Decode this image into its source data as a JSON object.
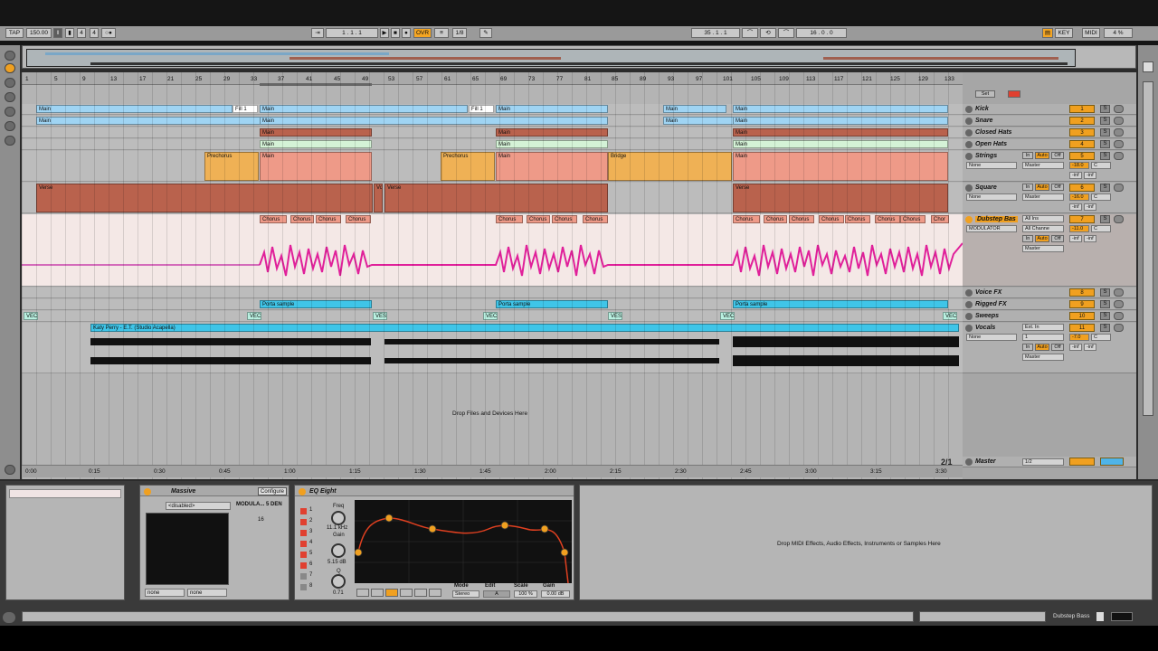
{
  "transport": {
    "tap": "TAP",
    "tempo": "150.00",
    "signature_num": "4",
    "signature_den": "4",
    "position": "1 . 1 . 1",
    "ovr": "OVR",
    "quant": "1/8",
    "loop_start": "35 . 1 . 1",
    "loop_length": "16 . 0 . 0",
    "key": "KEY",
    "midi": "MIDI",
    "cpu": "4 %"
  },
  "ruler_bars": [
    "1",
    "5",
    "9",
    "13",
    "17",
    "21",
    "25",
    "29",
    "33",
    "37",
    "41",
    "45",
    "49",
    "53",
    "57",
    "61",
    "65",
    "69",
    "73",
    "77",
    "81",
    "85",
    "89",
    "93",
    "97",
    "101",
    "105",
    "109",
    "113",
    "117",
    "121",
    "125",
    "129",
    "133"
  ],
  "timeline": [
    "0:00",
    "0:15",
    "0:30",
    "0:45",
    "1:00",
    "1:15",
    "1:30",
    "1:45",
    "2:00",
    "2:15",
    "2:30",
    "2:45",
    "3:00",
    "3:15",
    "3:30"
  ],
  "clips": {
    "main": "Main",
    "fill": "Fill 1",
    "prechorus": "Prechorus",
    "bridge": "Bridge",
    "verse": "Verse",
    "chorus": "Chorus",
    "porta": "Porta sample",
    "vec": "VEC",
    "ves": "VES",
    "vo": "Vo",
    "chor": "Chor",
    "acapella": "Katy Perry - E.T. (Studio Acapella)"
  },
  "drop_files": "Drop Files and Devices Here",
  "tracks": [
    {
      "name": "Kick",
      "num": "1"
    },
    {
      "name": "Snare",
      "num": "2"
    },
    {
      "name": "Closed Hats",
      "num": "3"
    },
    {
      "name": "Open Hats",
      "num": "4"
    },
    {
      "name": "Strings",
      "num": "5"
    },
    {
      "name": "Square",
      "num": "6"
    },
    {
      "name": "Dubstep Bas",
      "num": "7"
    },
    {
      "name": "Voice FX",
      "num": "8"
    },
    {
      "name": "Rigged FX",
      "num": "9"
    },
    {
      "name": "Sweeps",
      "num": "10"
    },
    {
      "name": "Vocals",
      "num": "11"
    }
  ],
  "master": {
    "name": "Master",
    "route": "1/2",
    "zoom": "2/1"
  },
  "track_fields": {
    "none": "None",
    "master": "Master",
    "in": "In",
    "auto": "Auto",
    "off": "Off",
    "all_ins": "All Ins",
    "all_channels": "All Channe",
    "modulator": "MODULATOR",
    "ext_in": "Ext. In",
    "one": "1",
    "s": "S",
    "set": "Set",
    "c": "C",
    "inf": "-inf",
    "strings_vol": "-18.0",
    "square_vol": "-16.0",
    "bass_vol": "-11.0",
    "vocals_vol": "-7.0"
  },
  "massive": {
    "title": "Massive",
    "configure": "Configure",
    "disabled": "<disabled>",
    "macro": "MODULA... 5 DEN",
    "macro_val": "16",
    "none1": "none",
    "none2": "none"
  },
  "eq": {
    "title": "EQ Eight",
    "freq_label": "Freq",
    "freq": "11.1 kHz",
    "gain_label": "Gain",
    "gain": "5.15 dB",
    "q_label": "Q",
    "q": "0.71",
    "mode_label": "Mode",
    "mode": "Stereo",
    "edit_label": "Edit",
    "edit": "A",
    "scale_label": "Scale",
    "scale": "100 %",
    "gain2_label": "Gain",
    "gain2": "0.00 dB",
    "bands": [
      "1",
      "2",
      "3",
      "4",
      "5",
      "6",
      "7",
      "8"
    ]
  },
  "drop_midi": "Drop MIDI Effects, Audio Effects, Instruments or Samples Here",
  "status": {
    "track": "Dubstep Bass"
  }
}
